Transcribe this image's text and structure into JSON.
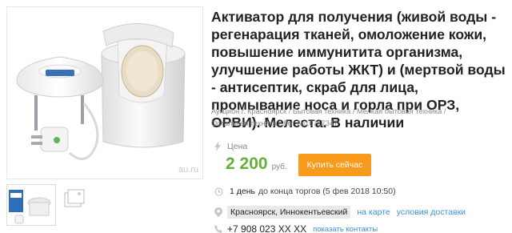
{
  "product": {
    "title": "Активатор для получения (живой воды - регенарация тканей, омоложение кожи, повышение иммунитита организма, улучшение работы ЖКТ) и (мертвой воды - антисептик, скраб для лица, промывание носа и горла при ОРЗ, ОРВИ). Мелеста. В наличии",
    "watermark": "au.ru"
  },
  "breadcrumbs": {
    "items": [
      "Аукцион г. Красноярск",
      "Бытовая техника",
      "Мелкая бытовая техника",
      "Остальная техника",
      "Лот №10717347"
    ],
    "separator": "/"
  },
  "price": {
    "label": "Цена",
    "value": "2 200",
    "currency": "руб.",
    "buy_label": "Купить сейчас"
  },
  "auction": {
    "days": "1 день",
    "rest": "до конца торгов (5 фев 2018 10:50)"
  },
  "location": {
    "city": "Красноярск, Иннокентьевский",
    "map_link": "на карте",
    "delivery_link": "условия доставки"
  },
  "contact": {
    "phone": "+7 908 023 XX XX",
    "show_link": "показать контакты"
  },
  "colors": {
    "price_green": "#66b033",
    "button_orange": "#f89a1c",
    "link_blue": "#3b8fd6"
  }
}
